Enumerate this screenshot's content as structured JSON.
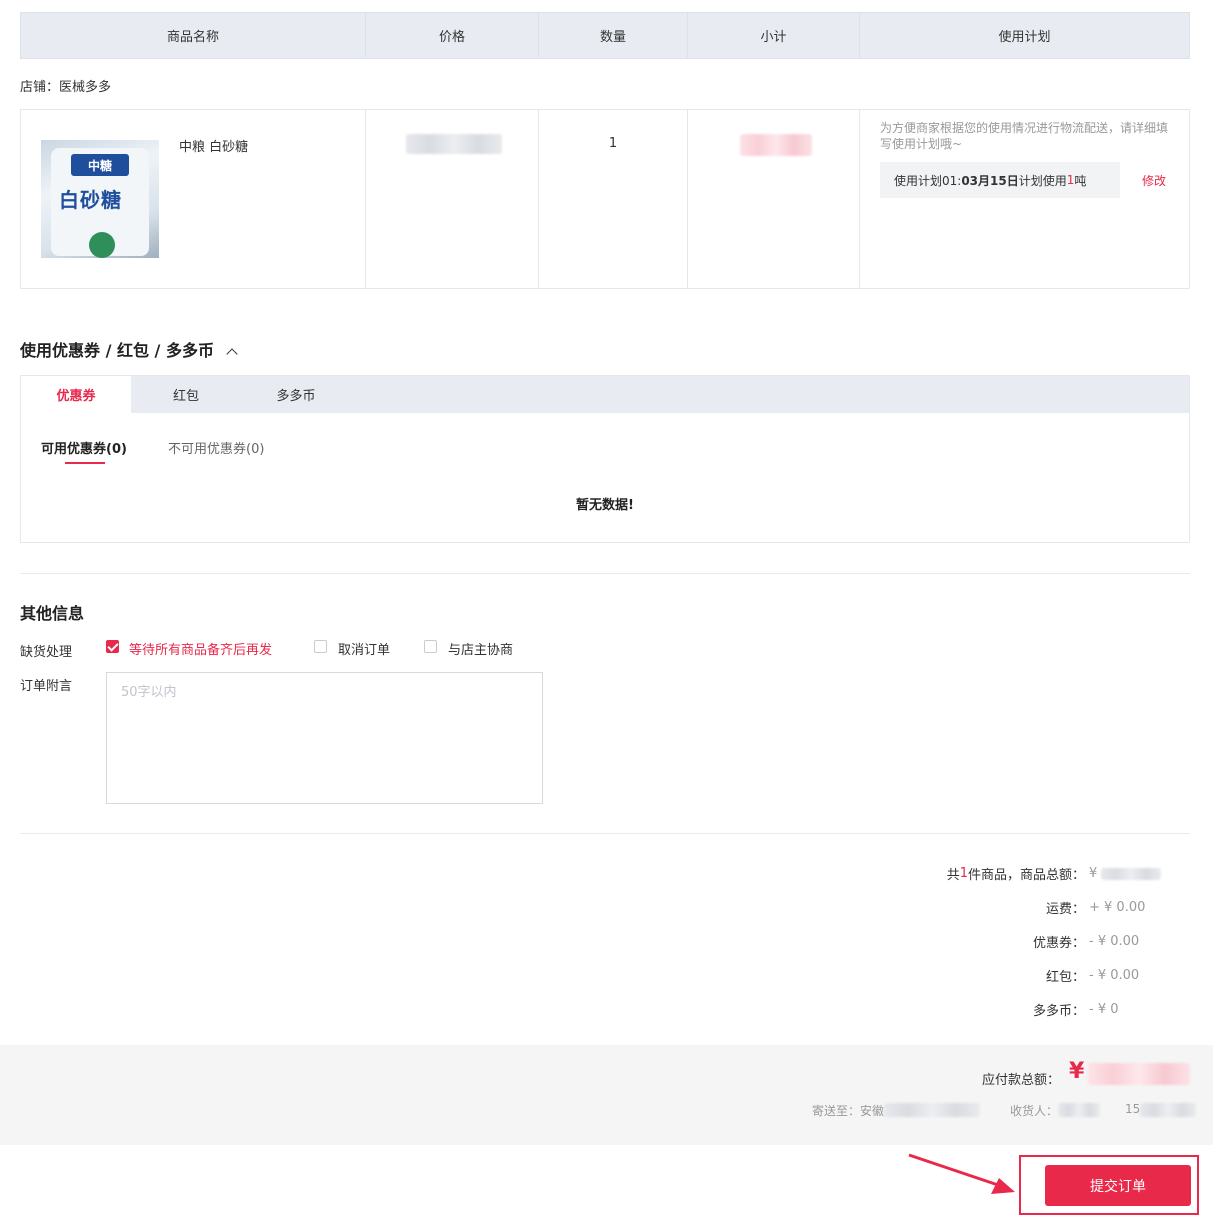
{
  "table": {
    "headers": [
      "商品名称",
      "价格",
      "数量",
      "小计",
      "使用计划"
    ],
    "shop_label": "店铺：医械多多",
    "item": {
      "name": "中粮 白砂糖",
      "quantity": "1",
      "image_logo_text": "中糖",
      "image_main_text": "白砂糖",
      "plan_tip": "为方便商家根据您的使用情况进行物流配送，请详细填写使用计划哦~",
      "plan_prefix": "使用计划01: ",
      "plan_date": "03月15日",
      "plan_mid": "计划使用 ",
      "plan_qty": "1",
      "plan_unit": " 吨",
      "plan_edit": "修改"
    }
  },
  "coupon": {
    "title": "使用优惠券 / 红包 / 多多币",
    "tabs": [
      "优惠券",
      "红包",
      "多多币"
    ],
    "subtabs": [
      "可用优惠券(0)",
      "不可用优惠券(0)"
    ],
    "empty": "暂无数据!"
  },
  "other": {
    "title": "其他信息",
    "stockout_label": "缺货处理",
    "options": [
      "等待所有商品备齐后再发",
      "取消订单",
      "与店主协商"
    ],
    "memo_label": "订单附言",
    "memo_placeholder": "50字以内"
  },
  "summary": {
    "count_prefix": "共 ",
    "count": "1",
    "count_suffix": " 件商品，商品总额：",
    "currency": "¥",
    "shipping_label": "运费：",
    "shipping_value": "+ ¥ 0.00",
    "coupon_label": "优惠券：",
    "coupon_value": "- ¥ 0.00",
    "redpacket_label": "红包：",
    "redpacket_value": "- ¥ 0.00",
    "coin_label": "多多币：",
    "coin_value": "- ¥ 0"
  },
  "footer": {
    "total_label": "应付款总额：",
    "total_currency": "¥",
    "ship_to_label": "寄送至：安徽",
    "receiver_label": "收货人：",
    "phone_prefix": "15"
  },
  "submit_label": "提交订单",
  "colors": {
    "accent": "#e8294a",
    "header_bg": "#e8ecf2"
  }
}
